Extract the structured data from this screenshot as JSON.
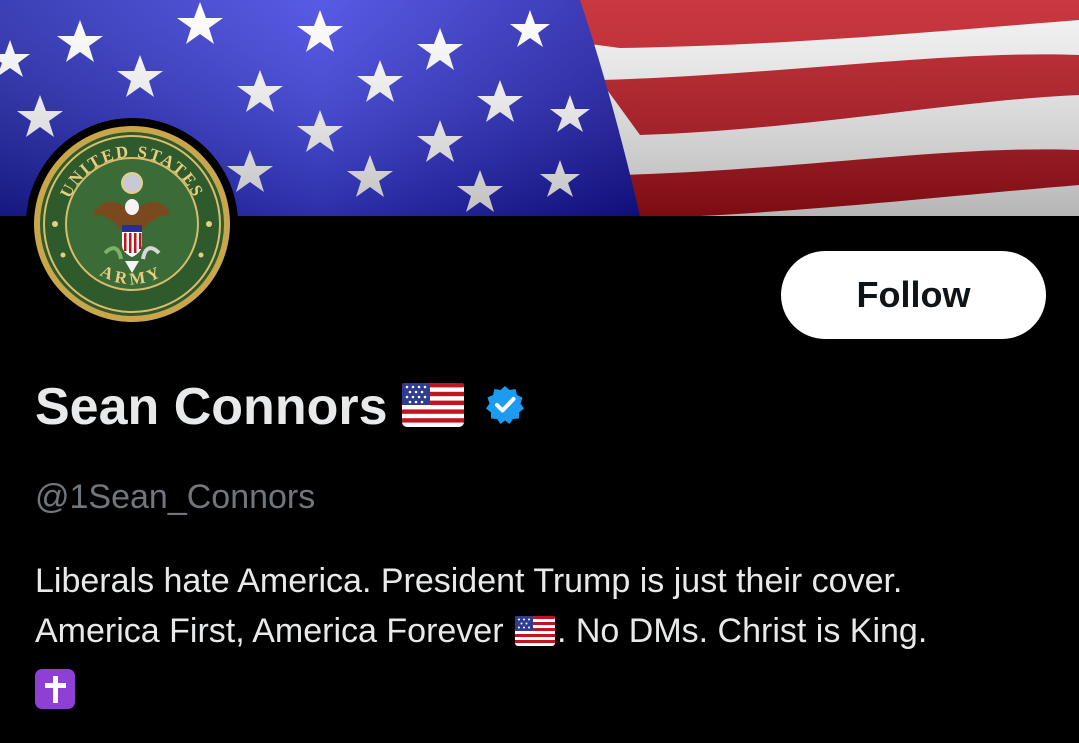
{
  "profile": {
    "name": "Sean Connors",
    "handle": "@1Sean_Connors",
    "verified_icon": "verified-badge-icon",
    "name_emoji": "us-flag-emoji"
  },
  "avatar": {
    "seal_top_text": "UNITED STATES",
    "seal_bottom_text": "ARMY"
  },
  "actions": {
    "follow_label": "Follow"
  },
  "bio": {
    "line1": "Liberals hate America. President Trump is just their cover.",
    "line2_before": "America First, America Forever",
    "line2_after": ". No DMs. Christ is King.",
    "emoji_flag": "us-flag-emoji",
    "emoji_cross": "latin-cross-emoji"
  },
  "colors": {
    "background": "#000000",
    "text": "#e7e9ea",
    "secondary_text": "#71767b",
    "verified_blue": "#1d9bf0",
    "follow_bg": "#ffffff"
  }
}
